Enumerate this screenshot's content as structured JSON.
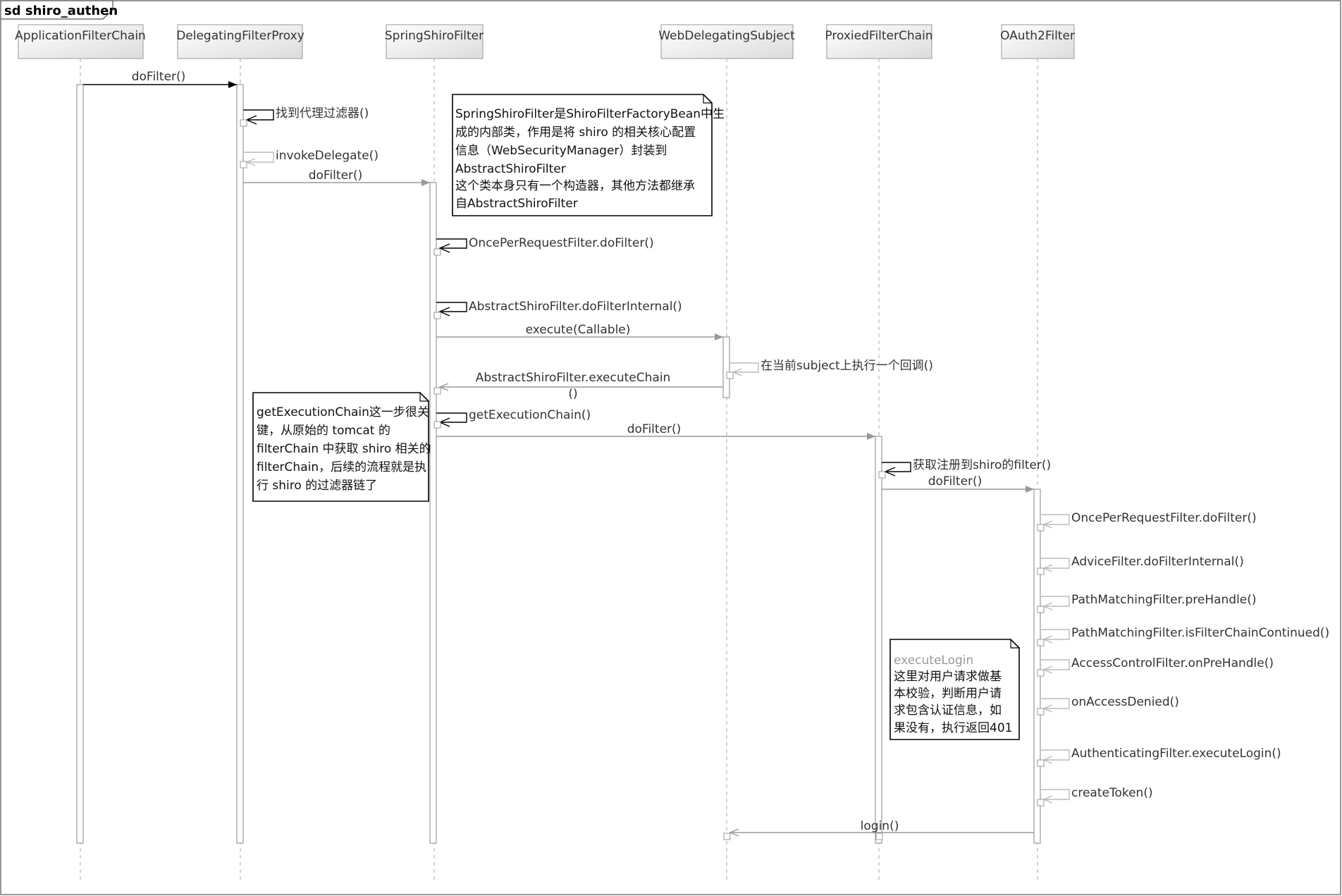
{
  "frame": {
    "title": "sd shiro_authen"
  },
  "lifelines": [
    {
      "id": "afc",
      "name": "ApplicationFilterChain"
    },
    {
      "id": "dfp",
      "name": "DelegatingFilterProxy"
    },
    {
      "id": "ssf",
      "name": "SpringShiroFilter"
    },
    {
      "id": "wds",
      "name": "WebDelegatingSubject"
    },
    {
      "id": "pfc",
      "name": "ProxiedFilterChain"
    },
    {
      "id": "o2f",
      "name": "OAuth2Filter"
    }
  ],
  "messages": [
    {
      "from": "afc",
      "to": "dfp",
      "label": "doFilter()",
      "kind": "call"
    },
    {
      "from": "dfp",
      "to": "dfp",
      "label": "找到代理过滤器()",
      "kind": "self"
    },
    {
      "from": "dfp",
      "to": "dfp",
      "label": "invokeDelegate()",
      "kind": "self"
    },
    {
      "from": "dfp",
      "to": "ssf",
      "label": "doFilter()",
      "kind": "call"
    },
    {
      "from": "ssf",
      "to": "ssf",
      "label": "OncePerRequestFilter.doFilter()",
      "kind": "self"
    },
    {
      "from": "ssf",
      "to": "ssf",
      "label": "AbstractShiroFilter.doFilterInternal()",
      "kind": "self"
    },
    {
      "from": "ssf",
      "to": "wds",
      "label": "execute(Callable)",
      "kind": "call"
    },
    {
      "from": "wds",
      "to": "wds",
      "label": "在当前subject上执行一个回调()",
      "kind": "self"
    },
    {
      "from": "wds",
      "to": "ssf",
      "label": [
        "AbstractShiroFilter.executeChain",
        "()"
      ],
      "kind": "call"
    },
    {
      "from": "ssf",
      "to": "ssf",
      "label": "getExecutionChain()",
      "kind": "self"
    },
    {
      "from": "ssf",
      "to": "pfc",
      "label": "doFilter()",
      "kind": "call"
    },
    {
      "from": "pfc",
      "to": "pfc",
      "label": "获取注册到shiro的filter()",
      "kind": "self"
    },
    {
      "from": "pfc",
      "to": "o2f",
      "label": "doFilter()",
      "kind": "call"
    },
    {
      "from": "o2f",
      "to": "o2f",
      "label": "OncePerRequestFilter.doFilter()",
      "kind": "self"
    },
    {
      "from": "o2f",
      "to": "o2f",
      "label": "AdviceFilter.doFilterInternal()",
      "kind": "self"
    },
    {
      "from": "o2f",
      "to": "o2f",
      "label": "PathMatchingFilter.preHandle()",
      "kind": "self"
    },
    {
      "from": "o2f",
      "to": "o2f",
      "label": "PathMatchingFilter.isFilterChainContinued()",
      "kind": "self"
    },
    {
      "from": "o2f",
      "to": "o2f",
      "label": "AccessControlFilter.onPreHandle()",
      "kind": "self"
    },
    {
      "from": "o2f",
      "to": "o2f",
      "label": "onAccessDenied()",
      "kind": "self"
    },
    {
      "from": "o2f",
      "to": "o2f",
      "label": "AuthenticatingFilter.executeLogin()",
      "kind": "self"
    },
    {
      "from": "o2f",
      "to": "o2f",
      "label": "createToken()",
      "kind": "self"
    },
    {
      "from": "o2f",
      "to": "wds",
      "label": "login()",
      "kind": "call"
    }
  ],
  "notes": [
    {
      "id": "note-springshirofilter",
      "lines": [
        "SpringShiroFilter是ShiroFilterFactoryBean中生",
        "成的内部类，作用是将 shiro 的相关核心配置",
        "信息（WebSecurityManager）封装到",
        "AbstractShiroFilter",
        "这个类本身只有一个构造器，其他方法都继承",
        "自AbstractShiroFilter"
      ]
    },
    {
      "id": "note-getexecutionchain",
      "lines": [
        "getExecutionChain这一步很关",
        "键，从原始的 tomcat 的",
        "filterChain 中获取 shiro 相关的",
        "filterChain，后续的流程就是执",
        "行 shiro 的过滤器链了"
      ]
    },
    {
      "id": "note-executelogin",
      "heading": "executeLogin",
      "lines": [
        "这里对用户请求做基",
        "本校验，判断用户请",
        "求包含认证信息，如",
        "果没有，执行返回401"
      ]
    }
  ]
}
